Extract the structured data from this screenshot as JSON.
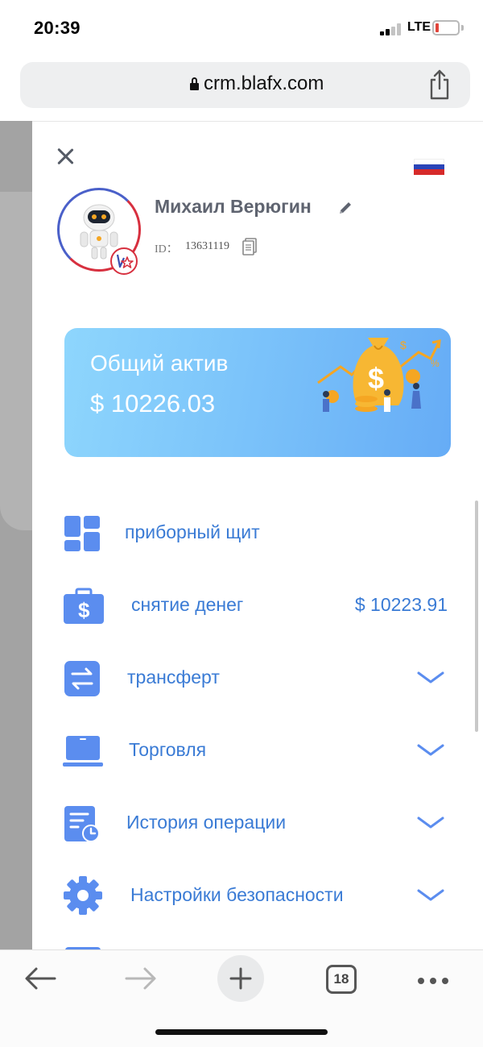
{
  "status_bar": {
    "time": "20:39",
    "network": "LTE",
    "battery_level": 0.12,
    "battery_color": "#e0443a"
  },
  "browser": {
    "url": "crm.blafx.com",
    "tab_count": "18",
    "icons": [
      "lock-icon",
      "share-icon",
      "back-arrow-icon",
      "forward-arrow-icon",
      "plus-icon",
      "more-icon"
    ]
  },
  "drawer": {
    "flag": "ru-flag-icon",
    "user": {
      "name": "Михаил Верюгин",
      "id_label": "ID：",
      "id_value": "13631119"
    },
    "asset_card": {
      "label": "Общий актив",
      "value": "$ 10226.03"
    },
    "menu": [
      {
        "label": "приборный щит",
        "icon": "dashboard-icon"
      },
      {
        "label": "снятие денег",
        "icon": "wallet-icon",
        "amount": "$ 10223.91"
      },
      {
        "label": "трансферт",
        "icon": "transfer-icon",
        "expandable": true
      },
      {
        "label": "Торговля",
        "icon": "laptop-icon",
        "expandable": true
      },
      {
        "label": "История операции",
        "icon": "history-icon",
        "expandable": true
      },
      {
        "label": "Настройки безопасности",
        "icon": "gear-icon",
        "expandable": true
      }
    ]
  },
  "colors": {
    "accent": "#3a7bd5",
    "icon_blue": "#5b8def",
    "card_gradient_start": "#8ed6fd",
    "card_gradient_end": "#66acf6"
  }
}
